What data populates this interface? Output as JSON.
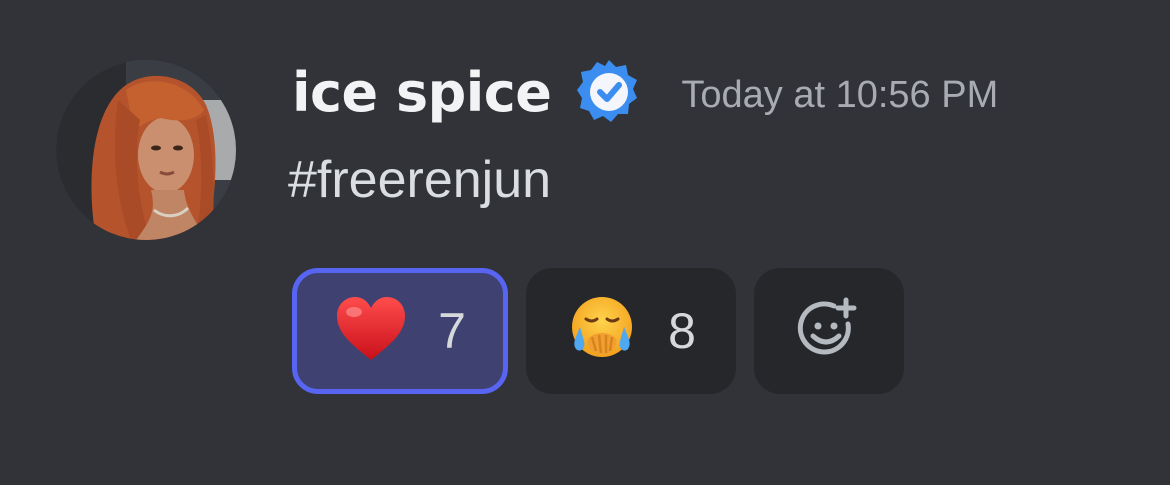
{
  "message": {
    "author": "ice spice",
    "verified": true,
    "timestamp": "Today at 10:56 PM",
    "content": "#freerenjun"
  },
  "reactions": [
    {
      "emoji": "heart-emoji",
      "count": "7",
      "active": true
    },
    {
      "emoji": "face-holding-back-tears-emoji",
      "count": "8",
      "active": false
    }
  ],
  "icons": {
    "verified_badge": "verified-badge-icon",
    "add_reaction": "add-reaction-icon"
  },
  "colors": {
    "background": "#313338",
    "verified": "#3b8ef0",
    "active_reaction_border": "#5865f2",
    "active_reaction_bg": "#3f4270",
    "reaction_bg": "#26272b"
  }
}
